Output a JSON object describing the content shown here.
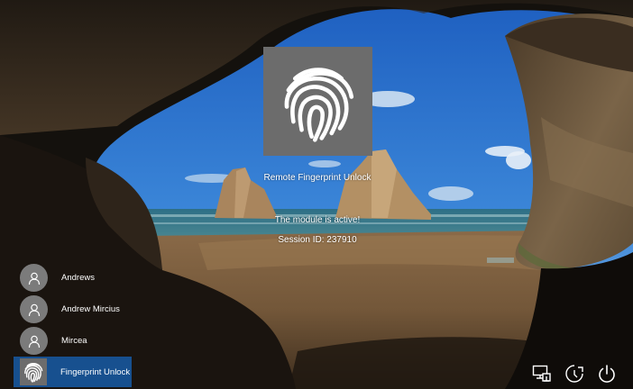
{
  "fingerprint_tile": {
    "icon": "fingerprint-icon"
  },
  "unlock_title": "Remote Fingerprint Unlock",
  "status_message": "The module is active!",
  "session_id": "Session ID: 237910",
  "users": [
    {
      "name": "Andrews",
      "icon": "user-icon"
    },
    {
      "name": "Andrew Mircius",
      "icon": "user-icon"
    },
    {
      "name": "Mircea",
      "icon": "user-icon"
    },
    {
      "name": "Fingerprint Unlock",
      "icon": "fingerprint-icon",
      "selected": true
    }
  ],
  "system_icons": [
    "network-icon",
    "ease-of-access-icon",
    "power-icon"
  ],
  "colors": {
    "selected_user_bg": "#17508f",
    "tile_bg": "#6c6c6c",
    "avatar_bg": "#7b7b7b"
  }
}
